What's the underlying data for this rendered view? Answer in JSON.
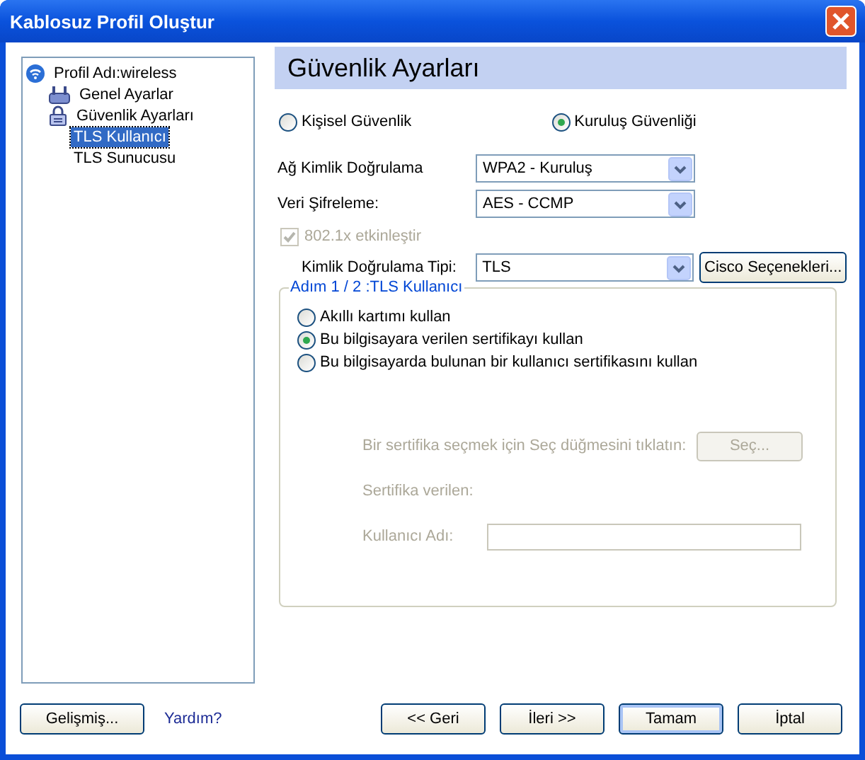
{
  "window": {
    "title": "Kablosuz Profil Oluştur"
  },
  "tree": [
    {
      "label": "Profil Adı:wireless",
      "kind": "wireless",
      "selected": false,
      "children": [
        {
          "label": "Genel Ayarlar",
          "kind": "adapter",
          "selected": false
        },
        {
          "label": "Güvenlik Ayarları",
          "kind": "lock",
          "selected": false,
          "children": [
            {
              "label": "TLS Kullanıcı",
              "selected": true
            },
            {
              "label": "TLS Sunucusu",
              "selected": false
            }
          ]
        }
      ]
    }
  ],
  "header": {
    "title": "Güvenlik Ayarları"
  },
  "security_modes": [
    {
      "label": "Kişisel Güvenlik",
      "selected": false
    },
    {
      "label": "Kuruluş Güvenliği",
      "selected": true
    }
  ],
  "dropdowns": [
    {
      "label": "Ağ Kimlik Doğrulama",
      "value": "WPA2 - Kuruluş"
    },
    {
      "label": "Veri Şifreleme:",
      "value": "AES - CCMP"
    }
  ],
  "enable_8021x": {
    "label": "802.1x etkinleştir",
    "checked": true,
    "disabled": true
  },
  "auth_type": {
    "label": "Kimlik Doğrulama Tipi:",
    "value": "TLS",
    "button": "Cisco Seçenekleri..."
  },
  "step_group": {
    "title": "Adım 1 / 2 :TLS Kullanıcı",
    "options": [
      {
        "label": "Akıllı kartımı kullan",
        "selected": false
      },
      {
        "label": "Bu bilgisayara verilen sertifikayı kullan",
        "selected": true
      },
      {
        "label": "Bu bilgisayarda bulunan bir kullanıcı sertifikasını kullan",
        "selected": false
      }
    ],
    "certificate": {
      "disabled": true,
      "prompt": "Bir sertifika seçmek için Seç düğmesini tıklatın:",
      "select_button": "Seç...",
      "issued_label": "Sertifika verilen:",
      "username_label": "Kullanıcı Adı:"
    }
  },
  "footer": {
    "advanced_button": "Gelişmiş...",
    "help_link": "Yardım?",
    "buttons": [
      {
        "label": "<< Geri",
        "default": false
      },
      {
        "label": "İleri >>",
        "default": false
      },
      {
        "label": "Tamam",
        "default": true
      },
      {
        "label": "İptal",
        "default": false
      }
    ]
  }
}
